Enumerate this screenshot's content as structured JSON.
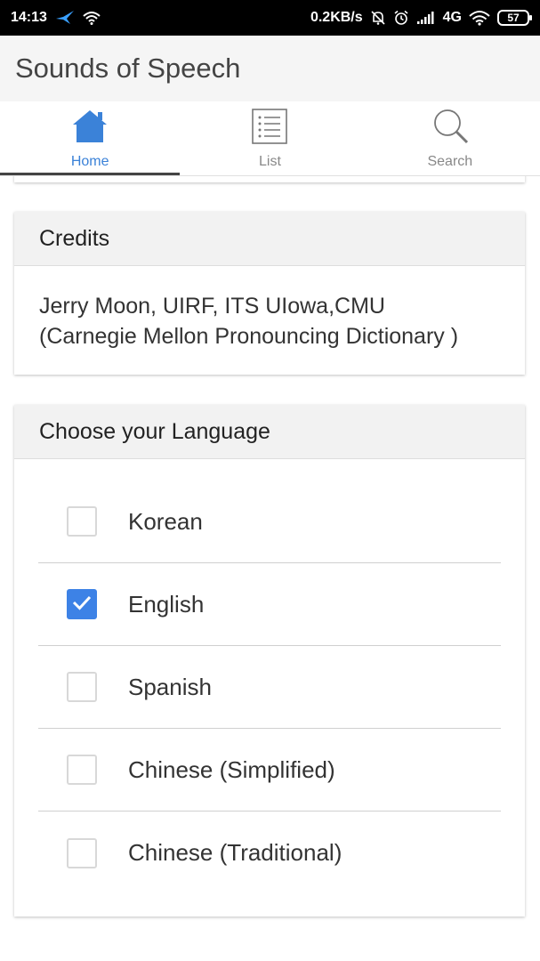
{
  "status_bar": {
    "time": "14:13",
    "net_speed": "0.2KB/s",
    "network": "4G",
    "battery": "57",
    "icons": [
      "bird-notification-icon",
      "wifi-icon",
      "mute-bell-icon",
      "alarm-icon",
      "signal-icon",
      "wifi-icon",
      "battery-icon"
    ]
  },
  "app": {
    "title": "Sounds of Speech"
  },
  "tabs": [
    {
      "label": "Home",
      "icon": "home-icon",
      "active": true
    },
    {
      "label": "List",
      "icon": "list-icon",
      "active": false
    },
    {
      "label": "Search",
      "icon": "search-icon",
      "active": false
    }
  ],
  "credits": {
    "header": "Credits",
    "line1": "Jerry Moon, UIRF, ITS UIowa,CMU",
    "line2": "(Carnegie Mellon Pronouncing Dictionary )"
  },
  "language": {
    "header": "Choose your Language",
    "options": [
      {
        "label": "Korean",
        "checked": false
      },
      {
        "label": "English",
        "checked": true
      },
      {
        "label": "Spanish",
        "checked": false
      },
      {
        "label": "Chinese (Simplified)",
        "checked": false
      },
      {
        "label": "Chinese (Traditional)",
        "checked": false
      }
    ]
  },
  "colors": {
    "accent": "#3b82d8",
    "checkbox_checked": "#3d82e6",
    "appbar_bg": "#f5f5f5"
  }
}
